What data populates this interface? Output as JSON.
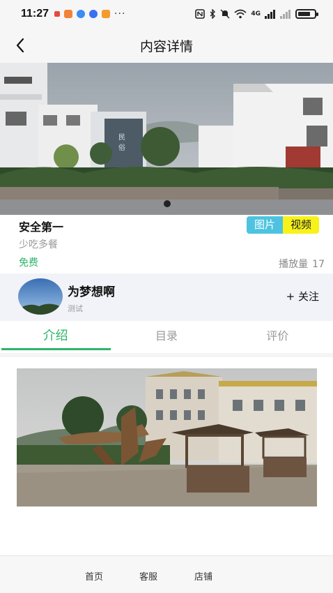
{
  "status_bar": {
    "time": "11:27",
    "more": "···",
    "notification_icons": [
      {
        "name": "red-flag-icon",
        "color": "#e54b3c"
      },
      {
        "name": "orange-app-icon",
        "color": "#f0833a"
      },
      {
        "name": "blue-app-icon",
        "color": "#3a8ef0"
      },
      {
        "name": "blue-app-icon-2",
        "color": "#3a6ff0"
      },
      {
        "name": "orange-play-icon",
        "color": "#f39c2c"
      }
    ],
    "signal_text": "4G",
    "battery_level": 0.75
  },
  "nav": {
    "title": "内容详情",
    "back_icon": "chevron-left-icon"
  },
  "detail": {
    "title": "安全第一",
    "subtitle": "少吃多餐",
    "price": "免费",
    "plays_label": "播放量",
    "plays_count": "17",
    "media_tabs": {
      "picture": "图片",
      "video": "视频"
    }
  },
  "author": {
    "name": "为梦想啊",
    "desc": "测试",
    "follow": "+ 关注"
  },
  "tabs": [
    {
      "label": "介绍",
      "active": true
    },
    {
      "label": "目录",
      "active": false
    },
    {
      "label": "评价",
      "active": false
    }
  ],
  "bottom_nav": {
    "home": "首页",
    "service": "客服",
    "shop": "店铺"
  },
  "colors": {
    "accent": "#2db46a",
    "picture_tab": "#4ec3e0",
    "video_tab": "#f7f21a"
  }
}
